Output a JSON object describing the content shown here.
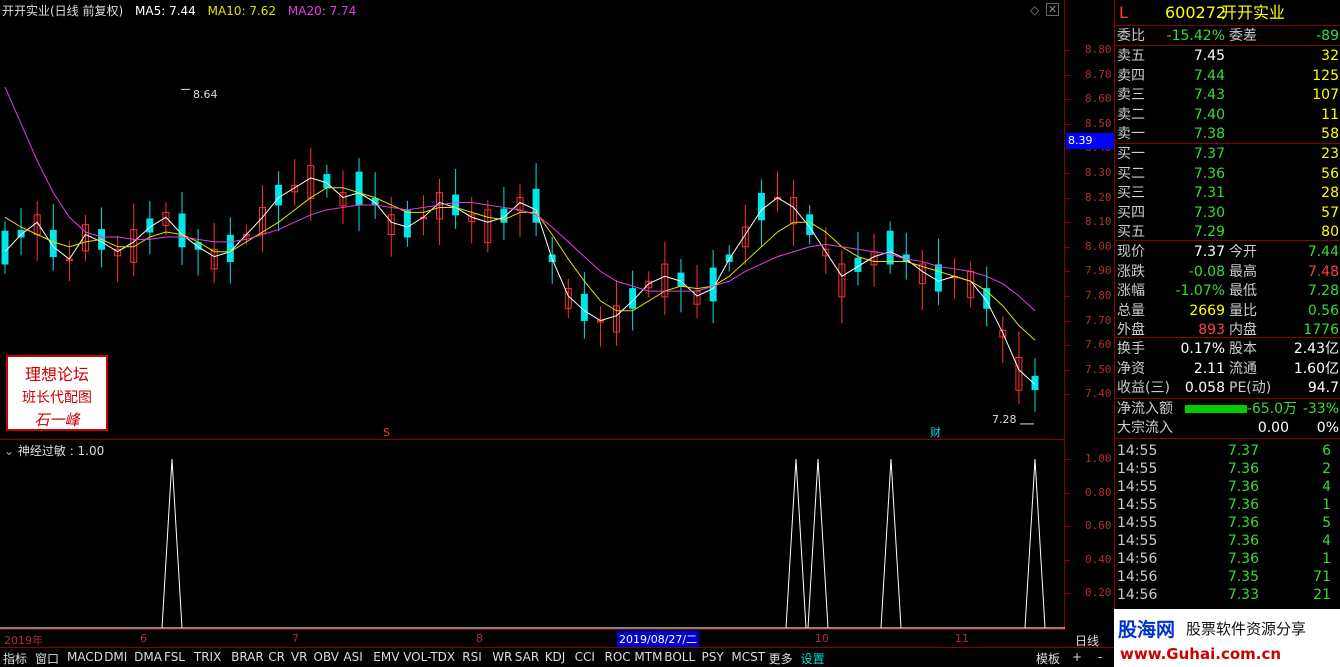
{
  "header": {
    "title": "开开实业(日线 前复权)",
    "ma5": "MA5: 7.44",
    "ma10": "MA10: 7.62",
    "ma20": "MA20: 7.74"
  },
  "main_axis": {
    "labels": [
      "8.80",
      "8.70",
      "8.60",
      "8.50",
      "8.40",
      "8.30",
      "8.20",
      "8.10",
      "8.00",
      "7.90",
      "7.80",
      "7.70",
      "7.60",
      "7.50",
      "7.40"
    ],
    "current_price_tag": "8.39"
  },
  "annotations": {
    "high": "8.64",
    "low": "7.28",
    "marker_s": "S",
    "marker_cai": "财"
  },
  "indicator": {
    "title": "神经过敏 : 1.00",
    "axis_labels": [
      "1.00",
      "0.80",
      "0.60",
      "0.40",
      "0.20"
    ]
  },
  "x_axis": {
    "labels": [
      "2019年",
      "6",
      "7",
      "8",
      "10",
      "11"
    ],
    "highlight": "2019/08/27/二",
    "period_btn": "日线"
  },
  "bottom_bar": [
    "指标",
    "窗口",
    "MACD",
    "DMI",
    "DMA",
    "FSL",
    "TRIX",
    "BRAR",
    "CR",
    "VR",
    "OBV",
    "ASI",
    "EMV",
    "VOL-TDX",
    "RSI",
    "WR",
    "SAR",
    "KDJ",
    "CCI",
    "ROC",
    "MTM",
    "BOLL",
    "PSY",
    "MCST",
    "更多",
    "设置",
    "模板"
  ],
  "watermark": {
    "line1": "理想论坛",
    "line2": "班长代配图",
    "line3": "石一峰"
  },
  "quote": {
    "flag": "L",
    "code": "600272",
    "name": "开开实业",
    "weibi_label": "委比",
    "weibi": "-15.42%",
    "weicha_label": "委差",
    "weicha": "-89",
    "asks": [
      {
        "label": "卖五",
        "price": "7.45",
        "vol": "32"
      },
      {
        "label": "卖四",
        "price": "7.44",
        "vol": "125"
      },
      {
        "label": "卖三",
        "price": "7.43",
        "vol": "107"
      },
      {
        "label": "卖二",
        "price": "7.40",
        "vol": "11"
      },
      {
        "label": "卖一",
        "price": "7.38",
        "vol": "58"
      }
    ],
    "bids": [
      {
        "label": "买一",
        "price": "7.37",
        "vol": "23"
      },
      {
        "label": "买二",
        "price": "7.36",
        "vol": "56"
      },
      {
        "label": "买三",
        "price": "7.31",
        "vol": "28"
      },
      {
        "label": "买四",
        "price": "7.30",
        "vol": "57"
      },
      {
        "label": "买五",
        "price": "7.29",
        "vol": "80"
      }
    ],
    "stats": [
      {
        "k1": "现价",
        "v1": "7.37",
        "k2": "今开",
        "v2": "7.44"
      },
      {
        "k1": "涨跌",
        "v1": "-0.08",
        "k2": "最高",
        "v2": "7.48"
      },
      {
        "k1": "涨幅",
        "v1": "-1.07%",
        "k2": "最低",
        "v2": "7.28"
      },
      {
        "k1": "总量",
        "v1": "2669",
        "k2": "量比",
        "v2": "0.56"
      },
      {
        "k1": "外盘",
        "v1": "893",
        "k2": "内盘",
        "v2": "1776"
      }
    ],
    "stats2": [
      {
        "k1": "换手",
        "v1": "0.17%",
        "k2": "股本",
        "v2": "2.43亿"
      },
      {
        "k1": "净资",
        "v1": "2.11",
        "k2": "流通",
        "v2": "1.60亿"
      },
      {
        "k1": "收益(三)",
        "v1": "0.058",
        "k2": "PE(动)",
        "v2": "94.7"
      }
    ],
    "flow": {
      "label": "净流入额",
      "value": "-65.0万",
      "pct": "-33%",
      "big_label": "大宗流入",
      "big_value": "0.00",
      "big_pct": "0%"
    },
    "ticks": [
      {
        "t": "14:55",
        "p": "7.37",
        "v": "6"
      },
      {
        "t": "14:55",
        "p": "7.36",
        "v": "2"
      },
      {
        "t": "14:55",
        "p": "7.36",
        "v": "4"
      },
      {
        "t": "14:55",
        "p": "7.36",
        "v": "1"
      },
      {
        "t": "14:55",
        "p": "7.36",
        "v": "5"
      },
      {
        "t": "14:55",
        "p": "7.36",
        "v": "4"
      },
      {
        "t": "14:56",
        "p": "7.36",
        "v": "1"
      },
      {
        "t": "14:56",
        "p": "7.35",
        "v": "71"
      },
      {
        "t": "14:56",
        "p": "7.33",
        "v": "21"
      }
    ]
  },
  "ad": {
    "brand": "股海网",
    "slogan": "股票软件资源分享",
    "url": "www.Guhai.com.cn"
  },
  "colors": {
    "up": "#ff3030",
    "down": "#00e5e5",
    "ma5": "#ffffff",
    "ma10": "#e0e000",
    "ma20": "#e040e0",
    "grid": "#8b0000"
  },
  "chart_data": [
    {
      "type": "candlestick",
      "title": "开开实业(日线 前复权)",
      "series": [
        {
          "name": "MA5",
          "values": [
            7.98,
            8.05,
            8.1,
            8.0,
            7.95,
            8.05,
            8.02,
            7.98,
            8.02,
            8.08,
            8.12,
            8.05,
            8.0,
            7.96,
            7.98,
            8.05,
            8.12,
            8.2,
            8.24,
            8.28,
            8.26,
            8.2,
            8.22,
            8.18,
            8.1,
            8.08,
            8.12,
            8.18,
            8.16,
            8.12,
            8.1,
            8.12,
            8.18,
            8.15,
            7.95,
            7.8,
            7.74,
            7.7,
            7.72,
            7.78,
            7.85,
            7.88,
            7.86,
            7.8,
            7.83,
            7.95,
            8.05,
            8.15,
            8.2,
            8.16,
            8.08,
            7.98,
            7.88,
            7.92,
            7.96,
            7.98,
            7.95,
            7.9,
            7.86,
            7.88,
            7.86,
            7.78,
            7.65,
            7.5,
            7.44
          ]
        },
        {
          "name": "MA10",
          "values": [
            8.12,
            8.08,
            8.05,
            8.02,
            8.0,
            8.02,
            8.03,
            8.0,
            8.0,
            8.04,
            8.06,
            8.05,
            8.02,
            7.98,
            7.98,
            8.02,
            8.06,
            8.1,
            8.15,
            8.2,
            8.24,
            8.24,
            8.22,
            8.2,
            8.17,
            8.14,
            8.14,
            8.16,
            8.16,
            8.14,
            8.12,
            8.11,
            8.14,
            8.14,
            8.05,
            7.95,
            7.86,
            7.78,
            7.74,
            7.74,
            7.78,
            7.82,
            7.84,
            7.83,
            7.84,
            7.88,
            7.94,
            8.0,
            8.06,
            8.1,
            8.1,
            8.06,
            8.0,
            7.96,
            7.94,
            7.94,
            7.94,
            7.92,
            7.9,
            7.88,
            7.86,
            7.82,
            7.76,
            7.68,
            7.62
          ]
        },
        {
          "name": "MA20",
          "values": [
            8.65,
            8.5,
            8.35,
            8.22,
            8.12,
            8.06,
            8.04,
            8.04,
            8.03,
            8.03,
            8.04,
            8.04,
            8.03,
            8.02,
            8.02,
            8.03,
            8.05,
            8.07,
            8.1,
            8.13,
            8.15,
            8.16,
            8.17,
            8.17,
            8.16,
            8.15,
            8.16,
            8.17,
            8.18,
            8.18,
            8.17,
            8.16,
            8.15,
            8.13,
            8.08,
            8.02,
            7.96,
            7.9,
            7.86,
            7.84,
            7.82,
            7.82,
            7.82,
            7.82,
            7.84,
            7.86,
            7.9,
            7.93,
            7.96,
            7.98,
            8.0,
            8.01,
            8.0,
            7.99,
            7.98,
            7.97,
            7.95,
            7.94,
            7.92,
            7.91,
            7.9,
            7.88,
            7.85,
            7.8,
            7.74
          ]
        }
      ],
      "high": 8.64,
      "low": 7.28,
      "ylim": [
        7.28,
        8.86
      ]
    },
    {
      "type": "line",
      "title": "神经过敏 : 1.00",
      "spikes_at": [
        7,
        33,
        34,
        37,
        44
      ],
      "ylim": [
        0,
        1.0
      ]
    }
  ]
}
